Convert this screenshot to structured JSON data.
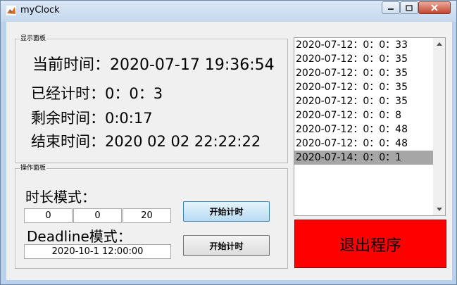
{
  "window": {
    "title": "myClock"
  },
  "display_panel": {
    "title": "显示面板",
    "current_time": "当前时间：2020-07-17 19:36:54",
    "elapsed": "已经计时：0：0：3",
    "remaining": "剩余时间：0:0:17",
    "end_time": "结束时间：2020 02 02 22:22:22"
  },
  "control_panel": {
    "title": "操作面板",
    "duration_label": "时长模式：",
    "duration_fields": [
      "0",
      "0",
      "20"
    ],
    "start_button_1": "开始计时",
    "deadline_label": "Deadline模式：",
    "deadline_value": "2020-10-1 12:00:00",
    "start_button_2": "开始计时"
  },
  "history": {
    "items": [
      "2020-07-12：0：0：33",
      "2020-07-12：0：0：35",
      "2020-07-12：0：0：35",
      "2020-07-12：0：0：35",
      "2020-07-12：0：0：35",
      "2020-07-12：0：0：8",
      "2020-07-12：0：0：48",
      "2020-07-12：0：0：48",
      "2020-07-14：0：0：1"
    ],
    "selected_index": 8
  },
  "exit_button": "退出程序",
  "colors": {
    "exit": "#ff0000",
    "selection": "#a6a6a6",
    "titlebar": "#c4d8ee"
  }
}
